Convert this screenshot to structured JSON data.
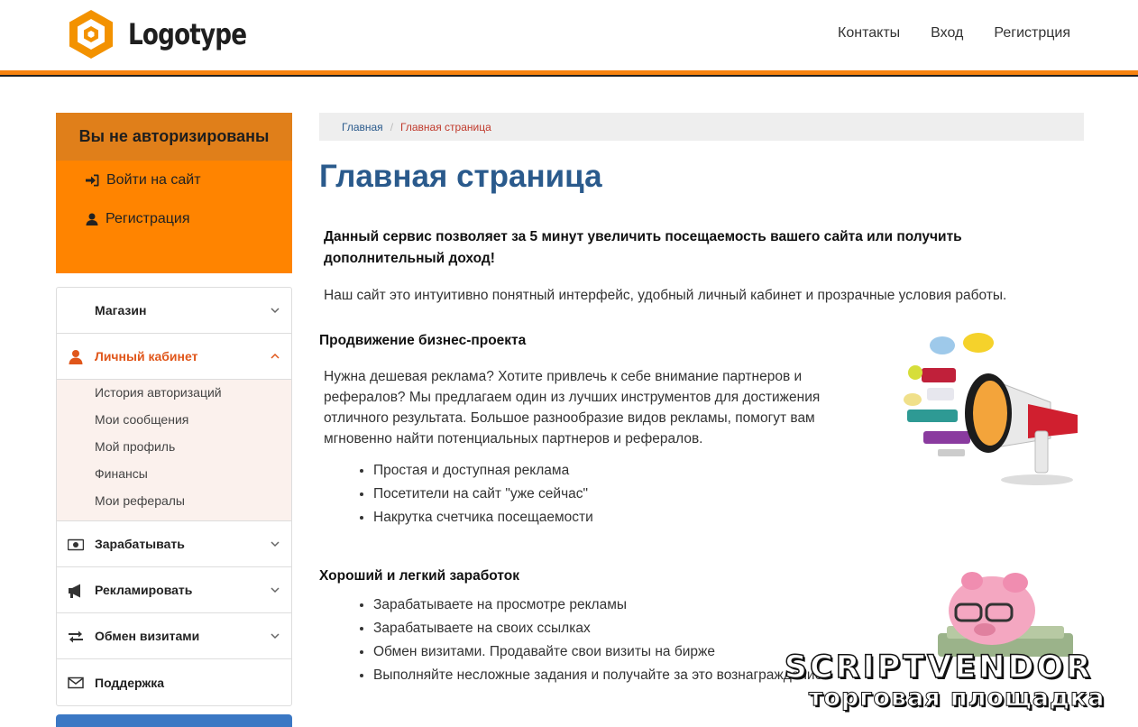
{
  "header": {
    "logo_text": "Logotype",
    "nav": [
      "Контакты",
      "Вход",
      "Регистрция"
    ],
    "accent_color": "#f7830f"
  },
  "sidebar": {
    "auth_title": "Вы не авторизированы",
    "auth_links": [
      {
        "icon": "sign-in-icon",
        "label": "Войти на сайт"
      },
      {
        "icon": "user-icon",
        "label": "Регистрация"
      }
    ],
    "menu": [
      {
        "icon": "",
        "label": "Магазин",
        "expanded": false
      },
      {
        "icon": "user-icon",
        "label": "Личный кабинет",
        "expanded": true,
        "children": [
          "История авторизаций",
          "Мои сообщения",
          "Мой профиль",
          "Финансы",
          "Мои рефералы"
        ]
      },
      {
        "icon": "money-icon",
        "label": "Зарабатывать",
        "expanded": false
      },
      {
        "icon": "bullhorn-icon",
        "label": "Рекламировать",
        "expanded": false
      },
      {
        "icon": "exchange-icon",
        "label": "Обмен визитами",
        "expanded": false
      },
      {
        "icon": "envelope-icon",
        "label": "Поддержка"
      }
    ]
  },
  "main": {
    "breadcrumb": {
      "home": "Главная",
      "separator": "/",
      "current": "Главная страница"
    },
    "title": "Главная страница",
    "lead": "Данный сервис позволяет за 5 минут увеличить посещаемость вашего сайта или получить дополнительный доход!",
    "intro": "Наш сайт это интуитивно понятный интерфейс, удобный личный кабинет и прозрачные условия работы.",
    "section1": {
      "title": "Продвижение бизнес-проекта",
      "text": "Нужна дешевая реклама? Хотите привлечь к себе внимание партнеров и рефералов? Мы предлагаем один из лучших инструментов для достижения отличного результата. Большое разнообразие видов рекламы, помогут вам мгновенно найти потенциальных партнеров и рефералов.",
      "items": [
        "Простая и доступная реклама",
        "Посетители на сайт \"уже сейчас\"",
        "Накрутка счетчика посещаемости"
      ]
    },
    "section2": {
      "title": "Хороший и легкий заработок",
      "items": [
        "Зарабатываете на просмотре рекламы",
        "Зарабатываете на своих ссылках",
        "Обмен визитами. Продавайте свои визиты на бирже",
        "Выполняйте несложные задания и получайте за это вознаграждение"
      ]
    }
  },
  "watermark": {
    "line1": "SCRIPTVENDOR",
    "line2": "торговая площадка"
  }
}
